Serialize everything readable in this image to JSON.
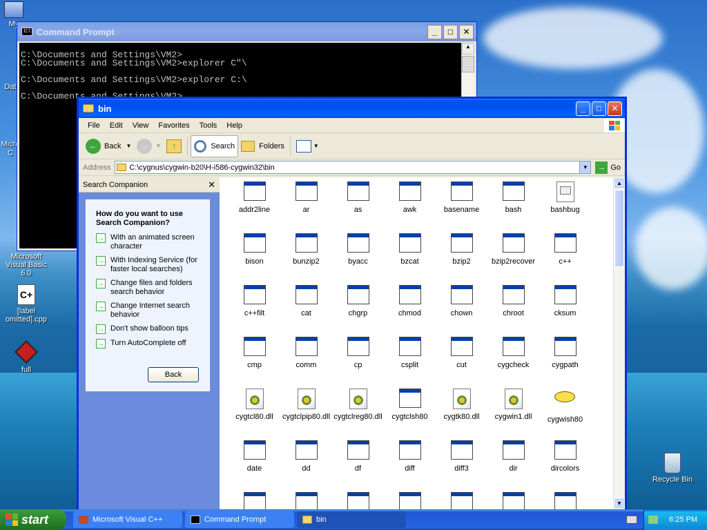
{
  "desktop": {
    "icons": [
      {
        "label": "My",
        "icon": "my-computer-icon"
      },
      {
        "label": "Dat",
        "icon": "folder-icon"
      },
      {
        "label": "Micro",
        "icon": "app-icon"
      },
      {
        "label": "C",
        "icon": "app-icon"
      },
      {
        "label": "Microsoft Visual Basic 6.0",
        "icon": "visual-basic-icon"
      },
      {
        "label": "[label omitted].cpp",
        "icon": "cpp-file-icon"
      },
      {
        "label": "full",
        "icon": "red-cube-icon"
      },
      {
        "label": "Recycle Bin",
        "icon": "recycle-bin-icon"
      }
    ]
  },
  "cmd": {
    "title": "Command Prompt",
    "icon_text": "C:\\",
    "lines": "C:\\Documents and Settings\\VM2>\nC:\\Documents and Settings\\VM2>explorer C\"\\\n\nC:\\Documents and Settings\\VM2>explorer C:\\\n\nC:\\Documents and Settings\\VM2>"
  },
  "explorer": {
    "title": "bin",
    "menu": [
      "File",
      "Edit",
      "View",
      "Favorites",
      "Tools",
      "Help"
    ],
    "toolbar": {
      "back": "Back",
      "search": "Search",
      "folders": "Folders"
    },
    "address_label": "Address",
    "address_value": "C:\\cygnus\\cygwin-b20\\H-i586-cygwin32\\bin",
    "go_label": "Go",
    "companion": {
      "title": "Search Companion",
      "question": "How do you want to use Search Companion?",
      "options": [
        "With an animated screen character",
        "With Indexing Service (for faster local searches)",
        "Change files and folders search behavior",
        "Change Internet search behavior",
        "Don't show balloon tips",
        "Turn AutoComplete off"
      ],
      "back": "Back"
    },
    "files": [
      {
        "name": "addr2line",
        "type": "exe"
      },
      {
        "name": "ar",
        "type": "exe"
      },
      {
        "name": "as",
        "type": "exe"
      },
      {
        "name": "awk",
        "type": "exe"
      },
      {
        "name": "basename",
        "type": "exe"
      },
      {
        "name": "bash",
        "type": "exe"
      },
      {
        "name": "bashbug",
        "type": "script"
      },
      {
        "name": "bison",
        "type": "exe"
      },
      {
        "name": "bunzip2",
        "type": "exe"
      },
      {
        "name": "byacc",
        "type": "exe"
      },
      {
        "name": "bzcat",
        "type": "exe"
      },
      {
        "name": "bzip2",
        "type": "exe"
      },
      {
        "name": "bzip2recover",
        "type": "exe"
      },
      {
        "name": "c++",
        "type": "exe"
      },
      {
        "name": "c++filt",
        "type": "exe"
      },
      {
        "name": "cat",
        "type": "exe"
      },
      {
        "name": "chgrp",
        "type": "exe"
      },
      {
        "name": "chmod",
        "type": "exe"
      },
      {
        "name": "chown",
        "type": "exe"
      },
      {
        "name": "chroot",
        "type": "exe"
      },
      {
        "name": "cksum",
        "type": "exe"
      },
      {
        "name": "cmp",
        "type": "exe"
      },
      {
        "name": "comm",
        "type": "exe"
      },
      {
        "name": "cp",
        "type": "exe"
      },
      {
        "name": "csplit",
        "type": "exe"
      },
      {
        "name": "cut",
        "type": "exe"
      },
      {
        "name": "cygcheck",
        "type": "exe"
      },
      {
        "name": "cygpath",
        "type": "exe"
      },
      {
        "name": "cygtcl80.dll",
        "type": "dll"
      },
      {
        "name": "cygtclpip80.dll",
        "type": "dll"
      },
      {
        "name": "cygtclreg80.dll",
        "type": "dll"
      },
      {
        "name": "cygtclsh80",
        "type": "exe"
      },
      {
        "name": "cygtk80.dll",
        "type": "dll"
      },
      {
        "name": "cygwin1.dll",
        "type": "dll"
      },
      {
        "name": "cygwish80",
        "type": "wish"
      },
      {
        "name": "date",
        "type": "exe"
      },
      {
        "name": "dd",
        "type": "exe"
      },
      {
        "name": "df",
        "type": "exe"
      },
      {
        "name": "diff",
        "type": "exe"
      },
      {
        "name": "diff3",
        "type": "exe"
      },
      {
        "name": "dir",
        "type": "exe"
      },
      {
        "name": "dircolors",
        "type": "exe"
      },
      {
        "name": "",
        "type": "exe"
      },
      {
        "name": "",
        "type": "exe"
      },
      {
        "name": "",
        "type": "exe"
      },
      {
        "name": "",
        "type": "exe"
      },
      {
        "name": "",
        "type": "exe"
      },
      {
        "name": "",
        "type": "exe"
      },
      {
        "name": "",
        "type": "exe"
      }
    ]
  },
  "taskbar": {
    "start": "start",
    "tasks": [
      {
        "label": "Microsoft Visual C++",
        "active": false
      },
      {
        "label": "Command Prompt",
        "active": false
      },
      {
        "label": "bin",
        "active": true
      }
    ],
    "clock": "6:25 PM"
  }
}
